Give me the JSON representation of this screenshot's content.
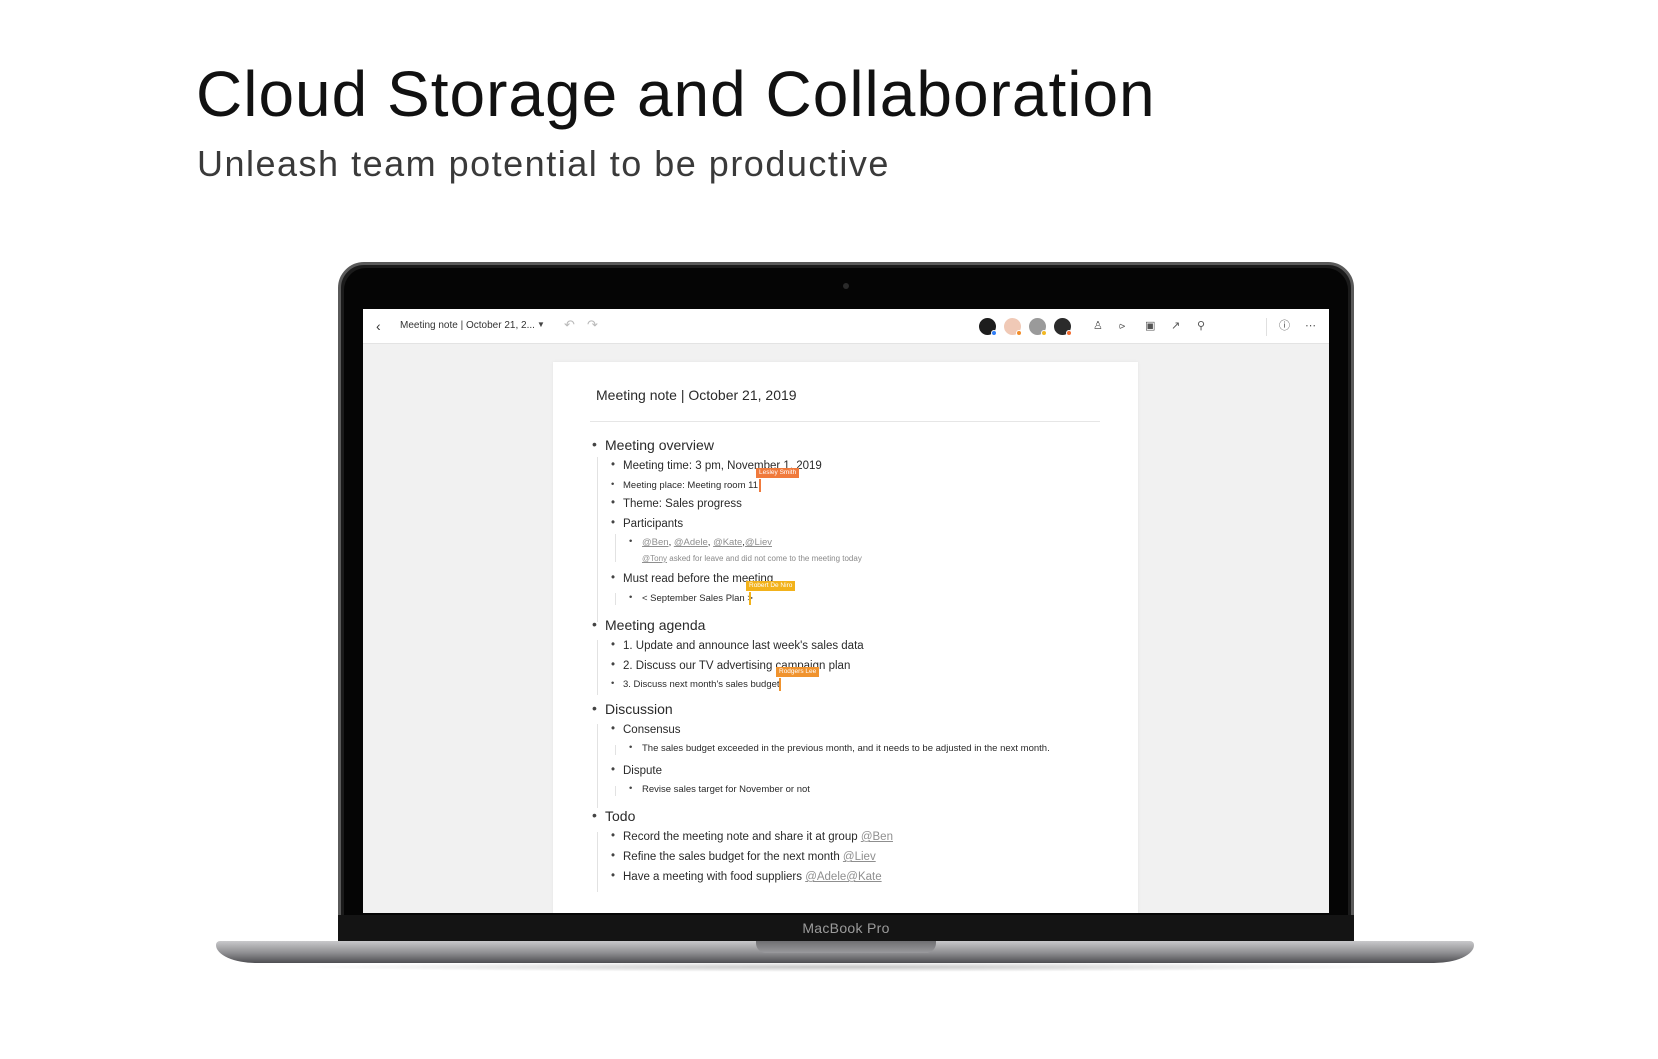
{
  "hero": {
    "title": "Cloud Storage and Collaboration",
    "subtitle": "Unleash team potential to be productive"
  },
  "device": {
    "label": "MacBook Pro"
  },
  "toolbar": {
    "back_icon": "chevron-left-icon",
    "doc_title": "Meeting note | October 21, 2...",
    "avatars": [
      {
        "name": "avatar-1",
        "bg": "#1d1d1d",
        "status": "#2f7df6"
      },
      {
        "name": "avatar-2",
        "bg": "#f0c9b6",
        "status": "#f28c28"
      },
      {
        "name": "avatar-3",
        "bg": "#9a9a9a",
        "status": "#f2b824"
      },
      {
        "name": "avatar-4",
        "bg": "#2b2b2b",
        "status": "#f26a2e"
      }
    ],
    "icons": [
      "collaborator-icon",
      "share-icon",
      "presentation-icon",
      "export-icon",
      "search-icon",
      "help-icon",
      "more-icon"
    ]
  },
  "document": {
    "heading": "Meeting note | October 21, 2019",
    "sections": {
      "overview": "Meeting overview",
      "overview_time": "Meeting time: 3 pm, November 1, 2019",
      "overview_place": "Meeting place: Meeting room 11",
      "overview_theme": "Theme: Sales progress",
      "overview_participants": "Participants",
      "participants_mentions": [
        "@Ben",
        "@Adele",
        "@Kate",
        "@Liev"
      ],
      "participants_note_mention": "@Tony",
      "participants_note": " asked for leave and did not come to the meeting today",
      "must_read": "Must read before the meeting",
      "must_read_item": "< September Sales Plan >",
      "agenda": "Meeting agenda",
      "agenda_1": "1. Update and announce last week's sales data",
      "agenda_2": "2. Discuss our TV advertising campaign plan",
      "agenda_3": "3. Discuss next month's sales budget",
      "discussion": "Discussion",
      "consensus": "Consensus",
      "consensus_item": "The sales budget exceeded in the previous month, and it needs to be adjusted in the next month.",
      "dispute": "Dispute",
      "dispute_item": "Revise sales target for November or not",
      "todo": "Todo",
      "todo_1": "Record the meeting note and share it at group ",
      "todo_1_mention": "@Ben",
      "todo_2": "Refine the sales budget for the next month ",
      "todo_2_mention": "@Liev",
      "todo_3": "Have a meeting with food suppliers ",
      "todo_3_mention": "@Adele@Kate"
    },
    "cursors": [
      {
        "name": "Lesley Smith",
        "color": "#f07a3c"
      },
      {
        "name": "Robert De Niro",
        "color": "#f2b21b"
      },
      {
        "name": "Rodgers Lee",
        "color": "#f0932e"
      }
    ]
  }
}
